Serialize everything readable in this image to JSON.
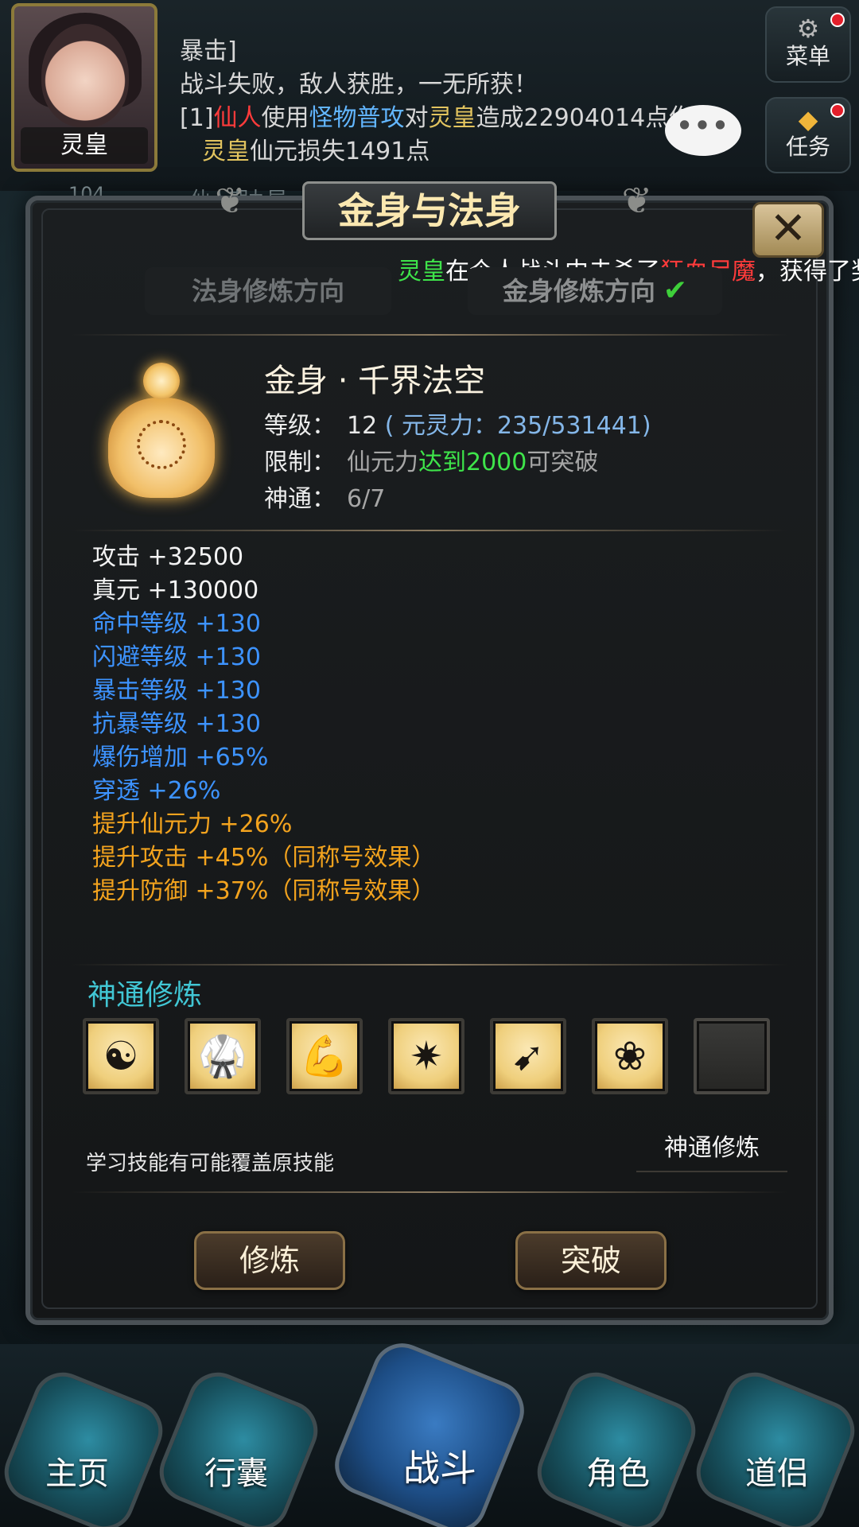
{
  "player": {
    "name": "灵皇"
  },
  "log": {
    "line1": "暴击]",
    "line2": "战斗失败，敌人获胜，一无所获！",
    "line3": {
      "prefix": "[1]",
      "actor": "仙人",
      "verb": "使用",
      "skill": "怪物普攻",
      "to": "对",
      "target": "灵皇",
      "rest": "造成22904014点伤害"
    },
    "line4": {
      "name": "灵皇",
      "rest": "仙元损失1491点"
    }
  },
  "chat_bubble": "•••",
  "side": {
    "menu": {
      "label": "菜单",
      "icon": "gear-icon"
    },
    "task": {
      "label": "任务",
      "icon": "diamond-icon"
    }
  },
  "status": {
    "level": "104",
    "text": "仙人期九层"
  },
  "dialog": {
    "title": "金身与法身",
    "close": "✕",
    "ticker": {
      "name": "灵皇",
      "mid": "在个人战斗中击杀了",
      "enemy": "狂血尸魔",
      "rest": "，获得了奖"
    },
    "tabs": [
      {
        "label": "法身修炼方向"
      },
      {
        "label": "金身修炼方向",
        "check": "✔"
      }
    ],
    "header": {
      "name": "金身 · 千界法空",
      "level_key": "等级：",
      "level_val": "12",
      "level_extra": "( 元灵力：235/531441)",
      "limit_key": "限制：",
      "limit_pre": "仙元力",
      "limit_green": "达到2000",
      "limit_post": "可突破",
      "power_key": "神通：",
      "power_val": "6/7"
    },
    "stats": [
      {
        "label": "攻击",
        "value": "+32500",
        "color": "white"
      },
      {
        "label": "真元",
        "value": "+130000",
        "color": "white"
      },
      {
        "label": "命中等级",
        "value": "+130",
        "color": "blue"
      },
      {
        "label": "闪避等级",
        "value": "+130",
        "color": "blue"
      },
      {
        "label": "暴击等级",
        "value": "+130",
        "color": "blue"
      },
      {
        "label": "抗暴等级",
        "value": "+130",
        "color": "blue"
      },
      {
        "label": "爆伤增加",
        "value": "+65%",
        "color": "blue"
      },
      {
        "label": "穿透",
        "value": "+26%",
        "color": "blue"
      },
      {
        "label": "提升仙元力",
        "value": "+26%",
        "color": "orange"
      },
      {
        "label": "提升攻击",
        "value": "+45%（同称号效果）",
        "color": "orange"
      },
      {
        "label": "提升防御",
        "value": "+37%（同称号效果）",
        "color": "orange"
      }
    ],
    "skill_section_title": "神通修炼",
    "skills": [
      {
        "icon": "yin-yang-icon",
        "glyph": "☯"
      },
      {
        "icon": "martial-kick-icon",
        "glyph": "🥋"
      },
      {
        "icon": "flexed-arm-icon",
        "glyph": "💪"
      },
      {
        "icon": "burst-explosion-icon",
        "glyph": "✷"
      },
      {
        "icon": "piercing-arrows-icon",
        "glyph": "➹"
      },
      {
        "icon": "lotus-icon",
        "glyph": "❀"
      },
      {
        "icon": "empty-slot-icon",
        "glyph": ""
      }
    ],
    "hint": "学习技能有可能覆盖原技能",
    "train_link": "神通修炼",
    "buttons": {
      "train": "修炼",
      "breakthrough": "突破"
    }
  },
  "nav": [
    {
      "label": "主页"
    },
    {
      "label": "行囊"
    },
    {
      "label": "战斗"
    },
    {
      "label": "角色"
    },
    {
      "label": "道侣"
    }
  ]
}
